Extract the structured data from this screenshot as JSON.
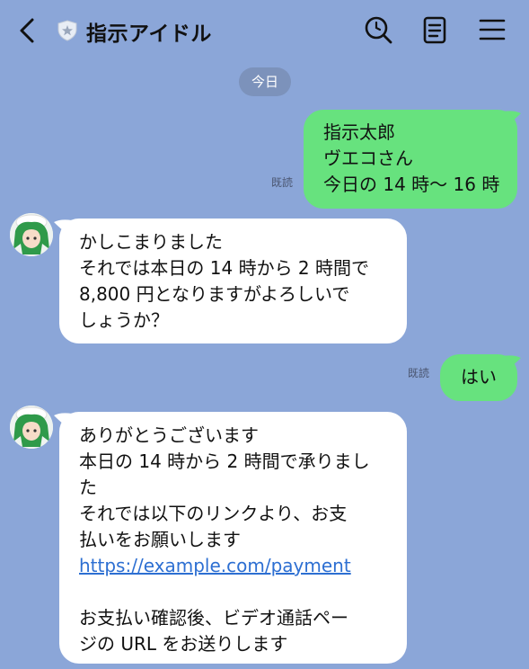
{
  "header": {
    "title": "指示アイドル",
    "back_icon": "chevron-left-icon",
    "shield_icon": "shield-icon",
    "search_icon": "search-icon",
    "notes_icon": "notes-icon",
    "menu_icon": "menu-icon"
  },
  "date_separator": "今日",
  "read_label": "既読",
  "messages": [
    {
      "sender": "me",
      "lines": [
        "指示太郎",
        "ヴエコさん",
        "今日の 14 時〜 16 時"
      ],
      "read": "既読"
    },
    {
      "sender": "idol",
      "lines": [
        "かしこまりました",
        "それでは本日の 14 時から 2 時間で",
        "8,800 円となりますがよろしいで",
        "しょうか？"
      ]
    },
    {
      "sender": "me",
      "lines": [
        "はい"
      ],
      "read": "既読"
    },
    {
      "sender": "idol",
      "lines": [
        "ありがとうございます",
        "本日の 14 時から 2 時間で承りまし",
        "た",
        "それでは以下のリンクより、お支",
        "払いをお願いします"
      ],
      "link": "https://example.com/payment",
      "lines_after": [
        "",
        "お支払い確認後、ビデオ通話ペー",
        "ジの URL をお送りします"
      ]
    }
  ],
  "colors": {
    "background": "#8BA6D8",
    "outgoing_bubble": "#67E27E",
    "incoming_bubble": "#FFFFFF",
    "link": "#2D6FD2",
    "date_pill": "#7C92BB"
  }
}
